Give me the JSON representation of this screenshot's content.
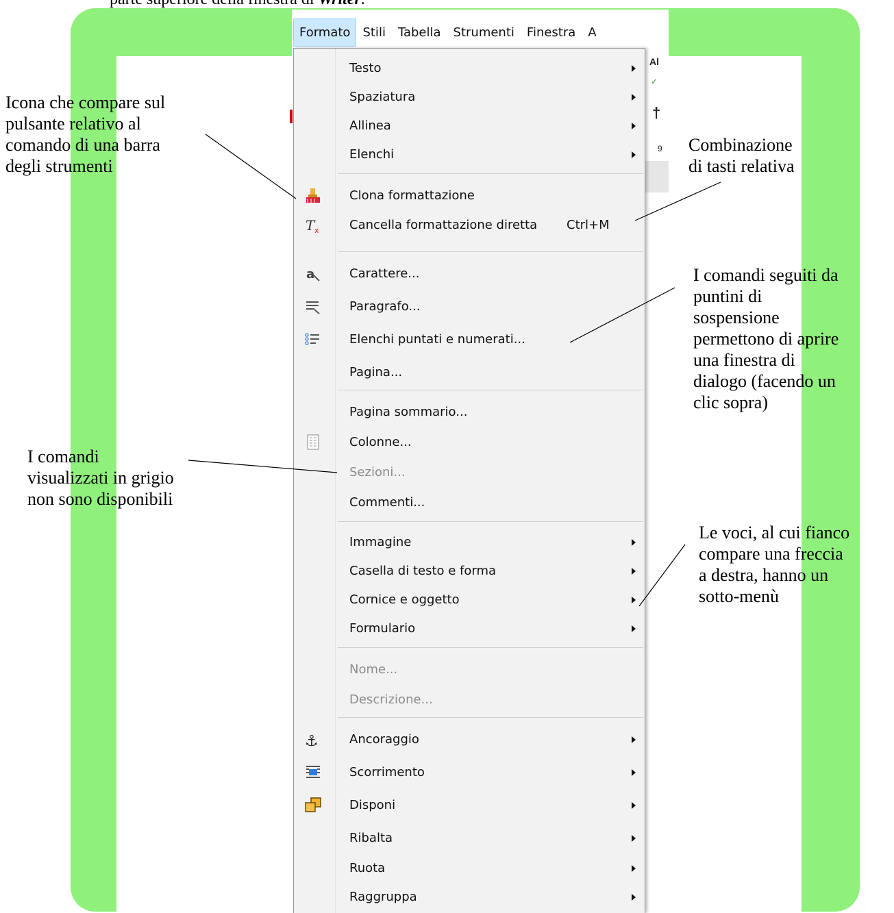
{
  "caption": {
    "text_start": "parte superiore della finestra di ",
    "app_name": "Writer",
    "text_end": "."
  },
  "menubar": {
    "items": [
      "Formato",
      "Stili",
      "Tabella",
      "Strumenti",
      "Finestra",
      "A"
    ]
  },
  "menu": {
    "testo": "Testo",
    "spaziatura": "Spaziatura",
    "allinea": "Allinea",
    "elenchi": "Elenchi",
    "clona": "Clona formattazione",
    "cancella": "Cancella formattazione diretta",
    "cancella_shortcut": "Ctrl+M",
    "carattere": "Carattere...",
    "paragrafo": "Paragrafo...",
    "elenchi_puntati": "Elenchi puntati e numerati...",
    "pagina": "Pagina...",
    "pagina_sommario": "Pagina sommario...",
    "colonne": "Colonne...",
    "sezioni": "Sezioni...",
    "commenti": "Commenti...",
    "immagine": "Immagine",
    "casella": "Casella di testo e forma",
    "cornice": "Cornice e oggetto",
    "formulario": "Formulario",
    "nome": "Nome...",
    "descrizione": "Descrizione...",
    "ancoraggio": "Ancoraggio",
    "scorrimento": "Scorrimento",
    "disponi": "Disponi",
    "ribalta": "Ribalta",
    "ruota": "Ruota",
    "raggruppa": "Raggruppa"
  },
  "app_peek": {
    "p1": "Al",
    "p2": "9"
  },
  "annotations": {
    "icona": [
      "Icona che compare sul",
      "pulsante relativo al",
      "comando di una barra",
      "degli strumenti"
    ],
    "combinazione": [
      "Combinazione",
      "di tasti relativa"
    ],
    "puntini": [
      "I comandi seguiti da",
      "puntini di",
      "sospensione",
      "permettono di aprire",
      "una finestra di",
      "dialogo (facendo un",
      "clic sopra)"
    ],
    "grigio": [
      "I comandi",
      "visualizzati in grigio",
      "non sono disponibili"
    ],
    "freccia": [
      "Le voci, al cui fianco",
      "compare una freccia",
      "a destra, hanno un",
      "sotto-menù"
    ]
  },
  "colors": {
    "frame_green": "#8ff07b",
    "menu_bg": "#f2f2f2",
    "active_menu": "#cce8ff",
    "disabled_text": "#8c8c8c"
  }
}
